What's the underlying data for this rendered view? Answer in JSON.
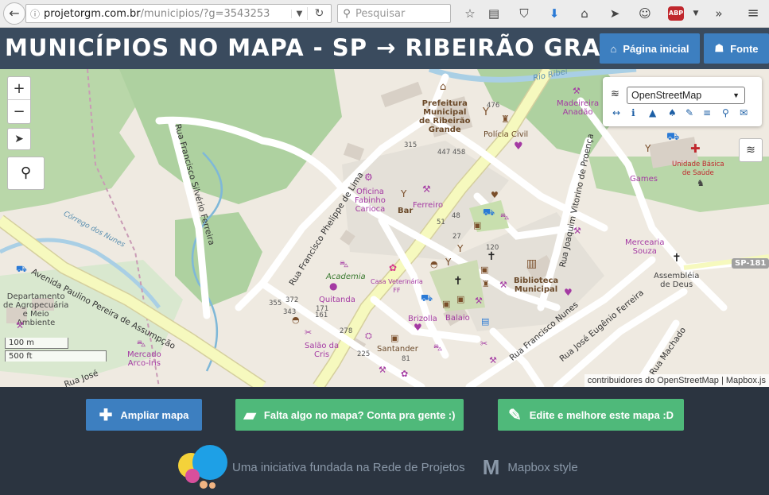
{
  "browser": {
    "url_host": "projetorgm.com.br",
    "url_path": "/municipios/?g=3543253",
    "search_placeholder": "Pesquisar",
    "adblock_label": "ABP"
  },
  "header": {
    "title": "MUNICÍPIOS NO MAPA - SP → RIBEIRÃO GRANDE",
    "home_button": "Página inicial",
    "source_button": "Fonte"
  },
  "map": {
    "zoom_in": "+",
    "zoom_out": "−",
    "layer_select": "OpenStreetMap",
    "scale_metric": "100 m",
    "scale_imperial": "500 ft",
    "attribution": "contribuidores do OpenStreetMap | Mapbox.js",
    "labels": {
      "prefeitura": "Prefeitura\nMunicipal\nde Ribeirão\nGrande",
      "policia": "Polícia Civil",
      "madeireira": "Madeireira\nAnadão",
      "unidade": "Unidade Básica\nde Saúde",
      "games": "Games",
      "oficina": "Oficina\nFabinho\nCarioca",
      "bar": "Bar",
      "ferreiro": "Ferreiro",
      "mercearia": "Mercearia\nSouza",
      "biblioteca": "Biblioteca\nMunicipal",
      "assembleia": "Assembléia\nde Deus",
      "academia": "Academia",
      "quitanda": "Quitanda",
      "casa_vet": "Casa Veterinária\nFF",
      "brizolla": "Brizolla",
      "balaio": "Balaio",
      "santander": "Santander",
      "salao": "Salão da\nCris",
      "mercado": "Mercado\nArco-Íris",
      "departamento": "Departamento\nde Agropecuária\ne Meio\nAmbiente",
      "corrego": "Córrego dos Nunes",
      "rio": "Rio Ribei"
    },
    "streets": {
      "silverio": "Rua Francisco Silvério Ferreira",
      "phelippe": "Rua Francisco Phelippe de Lima",
      "avenida": "Avenida Paulino Pereira de Assumpção",
      "vitorino": "Rua Joaquim Vitorino de Proença",
      "nunes": "Rua Francisco Nunes",
      "eugenio": "Rua José Eugênio Ferreira",
      "machado": "Rua Machado",
      "sp181": "SP-181",
      "jose": "Rua José"
    },
    "numbers": [
      "476",
      "315",
      "447",
      "458",
      "48",
      "51",
      "27",
      "120",
      "372",
      "355",
      "343",
      "171",
      "161",
      "278",
      "225",
      "81"
    ]
  },
  "footer": {
    "expand_button": "Ampliar mapa",
    "feedback_button": "Falta algo no mapa? Conta pra gente :)",
    "edit_button": "Edite e melhore este mapa :D",
    "initiative_text": "Uma iniciativa fundada na Rede de Projetos",
    "mapbox_text": "Mapbox style",
    "mapbox_letter": "M"
  },
  "colors": {
    "header_bg": "#3a4b5e",
    "footer_bg": "#2b3440",
    "blue_button": "#3d7fc0",
    "green_button": "#4fb97a",
    "map_bg": "#efeae1",
    "forest": "#aed1a0",
    "road_yellow": "#f6f9be"
  }
}
